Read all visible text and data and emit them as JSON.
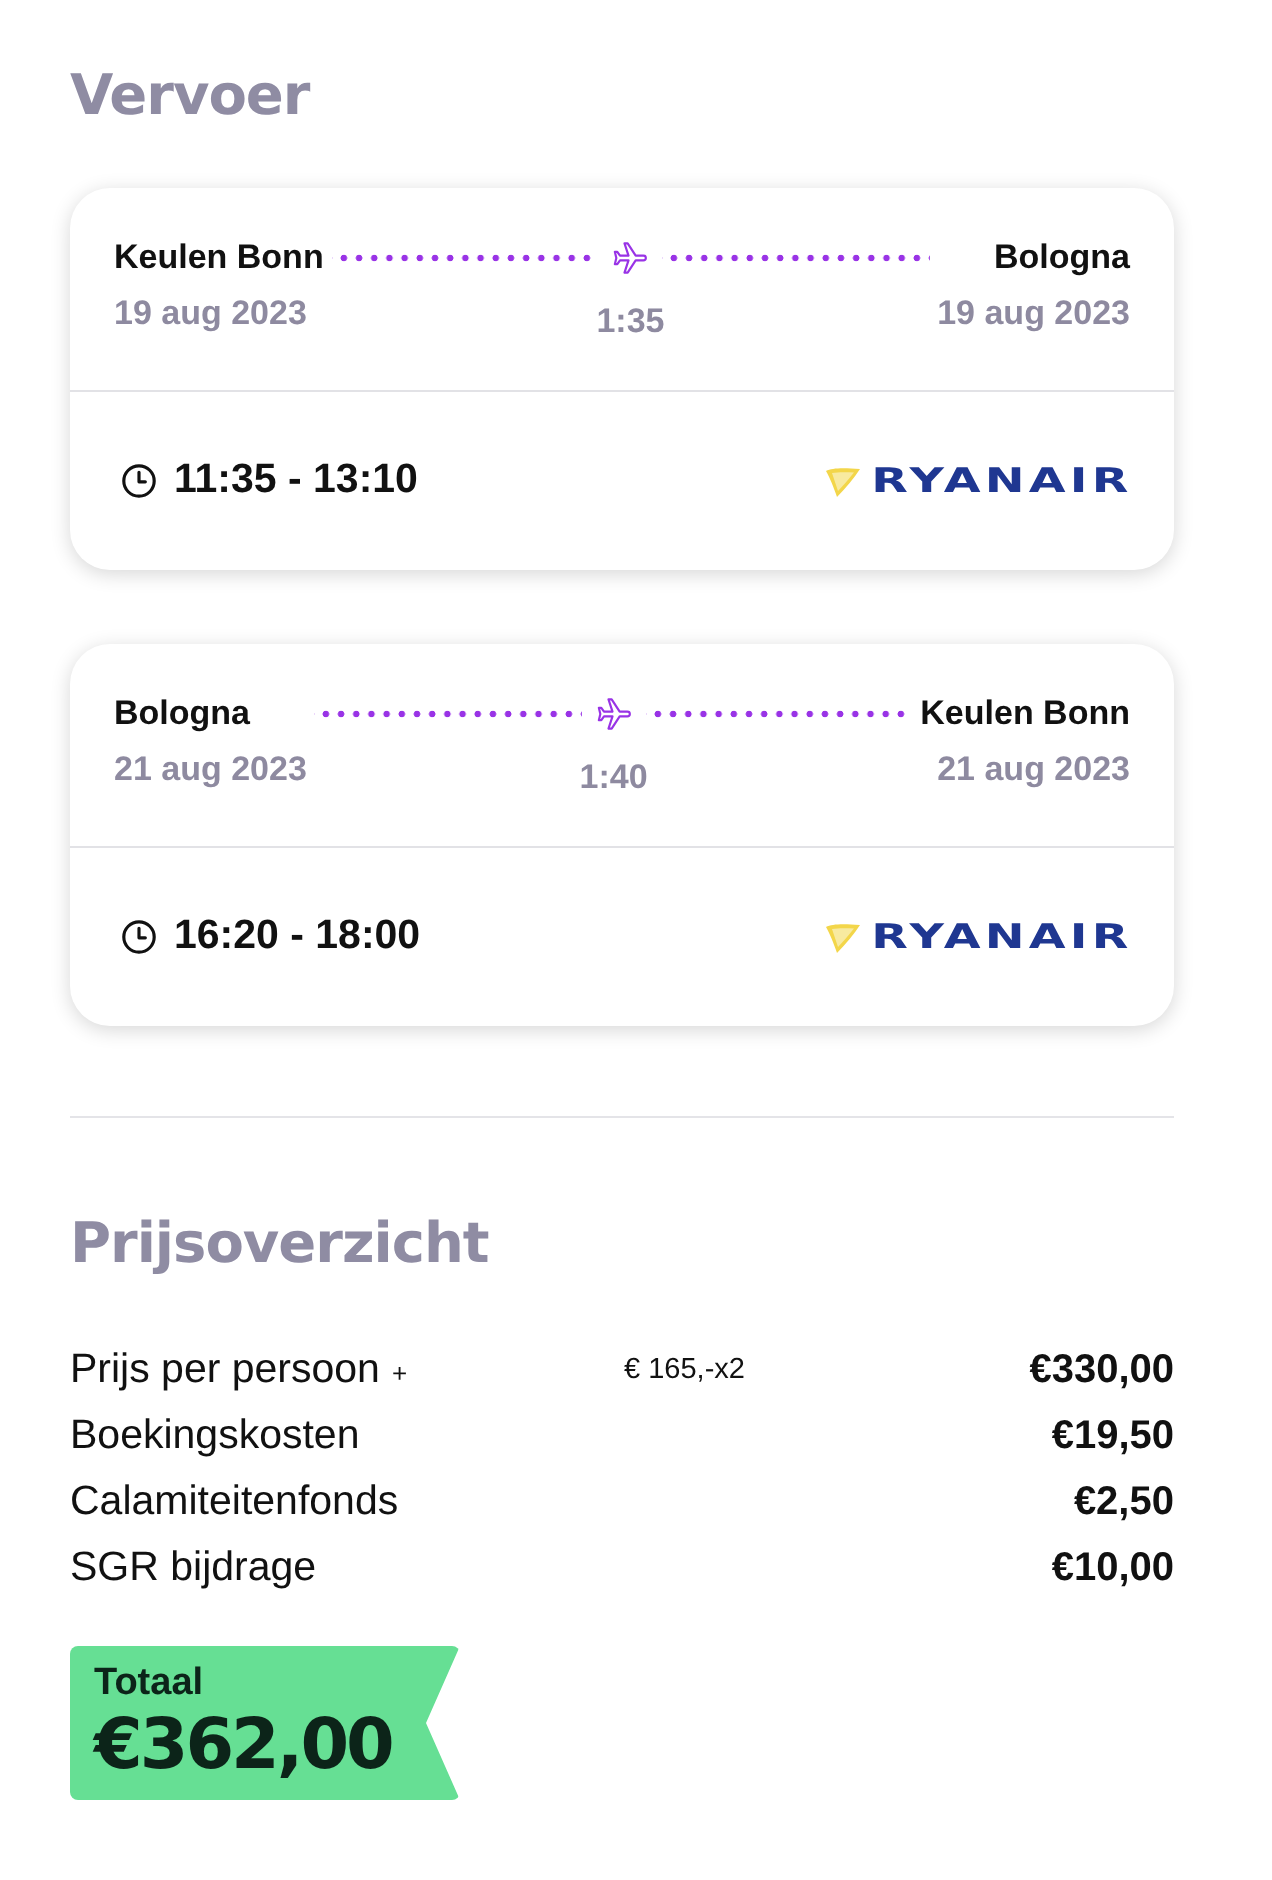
{
  "transport_title": "Vervoer",
  "flights": [
    {
      "from": "Keulen Bonn",
      "from_date": "19 aug 2023",
      "to": "Bologna",
      "to_date": "19 aug 2023",
      "duration": "1:35",
      "times": "11:35 - 13:10",
      "airline": "RYANAIR"
    },
    {
      "from": "Bologna",
      "from_date": "21 aug 2023",
      "to": "Keulen Bonn",
      "to_date": "21 aug 2023",
      "duration": "1:40",
      "times": "16:20 - 18:00",
      "airline": "RYANAIR"
    }
  ],
  "price_title": "Prijsoverzicht",
  "price_rows": [
    {
      "label": "Prijs per persoon",
      "toggle": "+",
      "detail": "€ 165,-x2",
      "amount": "€330,00"
    },
    {
      "label": "Boekingskosten",
      "amount": "€19,50"
    },
    {
      "label": "Calamiteitenfonds",
      "amount": "€2,50"
    },
    {
      "label": "SGR bijdrage",
      "amount": "€10,00"
    }
  ],
  "total": {
    "label": "Totaal",
    "amount": "€362,00"
  }
}
